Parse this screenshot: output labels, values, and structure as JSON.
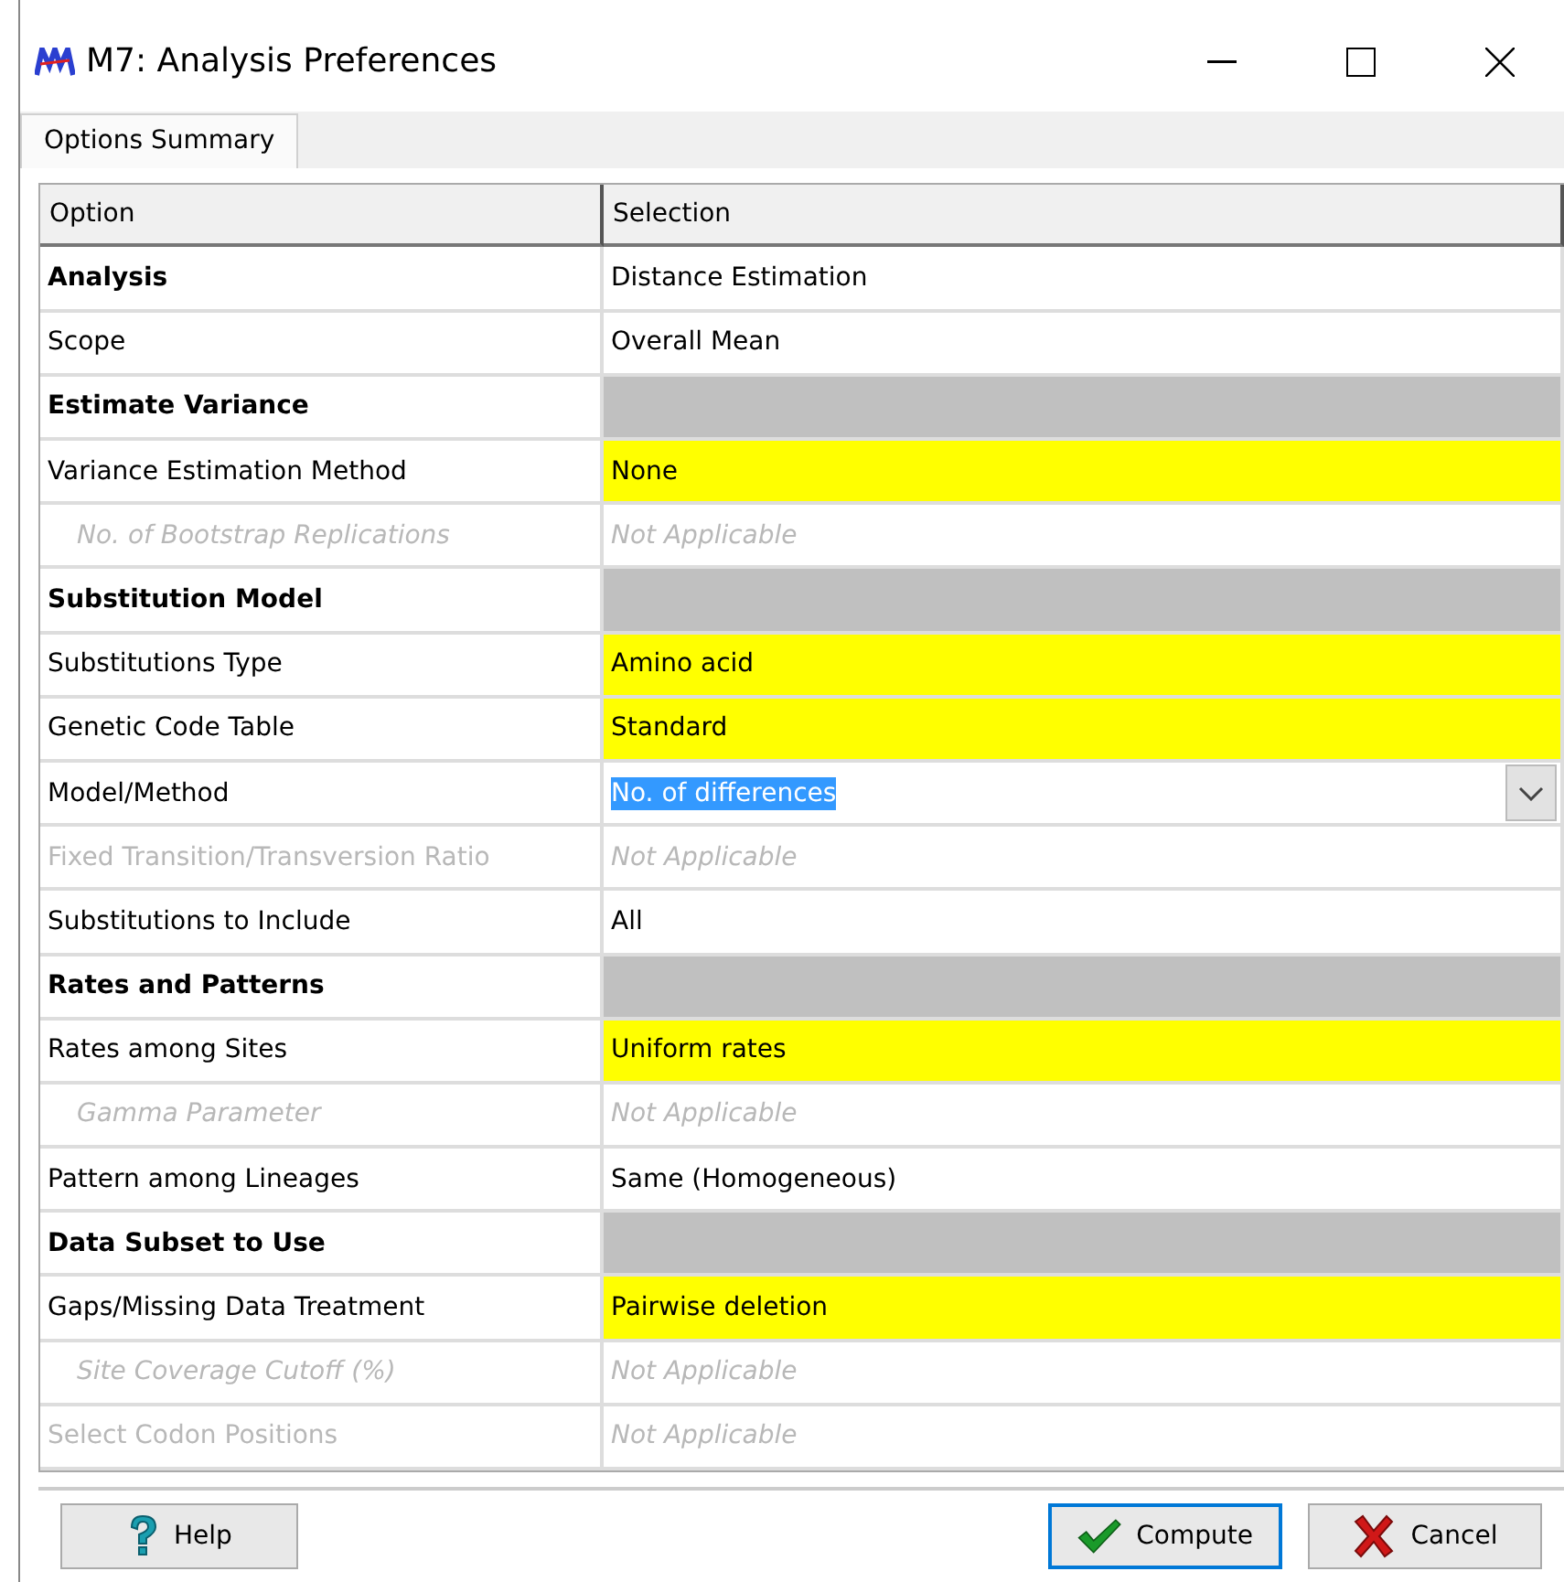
{
  "window": {
    "title": "M7: Analysis Preferences"
  },
  "tabs": [
    {
      "label": "Options Summary",
      "selected": true
    }
  ],
  "table": {
    "columns": [
      "Option",
      "Selection"
    ],
    "rows": [
      {
        "kind": "section",
        "option": "Analysis",
        "selection": "Distance Estimation"
      },
      {
        "kind": "option",
        "option": "Scope",
        "selection": "Overall Mean",
        "highlighted": false,
        "disabled": false
      },
      {
        "kind": "section",
        "option": "Estimate Variance"
      },
      {
        "kind": "option",
        "option": "Variance Estimation Method",
        "selection": "None",
        "highlighted": true,
        "disabled": false,
        "children": [
          {
            "kind": "option",
            "option": "No. of Bootstrap Replications",
            "selection": "Not Applicable",
            "highlighted": false,
            "disabled": true
          }
        ]
      },
      {
        "kind": "section",
        "option": "Substitution Model"
      },
      {
        "kind": "option",
        "option": "Substitutions Type",
        "selection": "Amino acid",
        "highlighted": true,
        "disabled": false
      },
      {
        "kind": "option",
        "option": "Genetic Code Table",
        "selection": "Standard",
        "highlighted": true,
        "disabled": false
      },
      {
        "kind": "dropdown",
        "option": "Model/Method",
        "selection": "No. of differences",
        "highlighted": false,
        "disabled": false
      },
      {
        "kind": "option",
        "option": "Fixed Transition/Transversion Ratio",
        "selection": "Not Applicable",
        "highlighted": false,
        "disabled": true
      },
      {
        "kind": "option",
        "option": "Substitutions to Include",
        "selection": "All",
        "highlighted": false,
        "disabled": false
      },
      {
        "kind": "section",
        "option": "Rates and Patterns"
      },
      {
        "kind": "option",
        "option": "Rates among Sites",
        "selection": "Uniform rates",
        "highlighted": true,
        "disabled": false,
        "children": [
          {
            "kind": "option",
            "option": "Gamma Parameter",
            "selection": "Not Applicable",
            "highlighted": false,
            "disabled": true
          }
        ]
      },
      {
        "kind": "option",
        "option": "Pattern among Lineages",
        "selection": "Same (Homogeneous)",
        "highlighted": false,
        "disabled": false
      },
      {
        "kind": "section",
        "option": "Data Subset to Use"
      },
      {
        "kind": "option",
        "option": "Gaps/Missing Data Treatment",
        "selection": "Pairwise deletion",
        "highlighted": true,
        "disabled": false,
        "children": [
          {
            "kind": "option",
            "option": "Site Coverage Cutoff (%)",
            "selection": "Not Applicable",
            "highlighted": false,
            "disabled": true
          }
        ]
      },
      {
        "kind": "option",
        "option": "Select Codon Positions",
        "selection": "Not Applicable",
        "highlighted": false,
        "disabled": true
      }
    ]
  },
  "buttons": [
    {
      "kind": "help",
      "label": "Help",
      "focused": false
    },
    {
      "kind": "compute",
      "label": "Compute",
      "focused": true
    },
    {
      "kind": "cancel",
      "label": "Cancel",
      "focused": false
    }
  ]
}
